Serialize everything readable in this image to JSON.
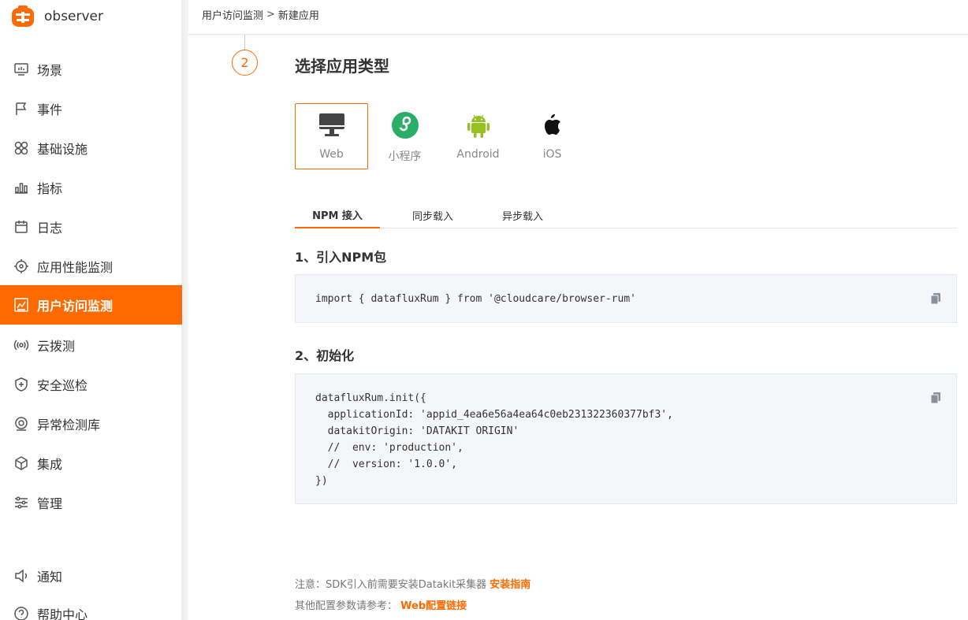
{
  "brand": {
    "name": "observer"
  },
  "sidebar": {
    "items": [
      {
        "label": "场景",
        "icon": "monitor-icon"
      },
      {
        "label": "事件",
        "icon": "flag-icon"
      },
      {
        "label": "基础设施",
        "icon": "infrastructure-icon"
      },
      {
        "label": "指标",
        "icon": "bar-chart-icon"
      },
      {
        "label": "日志",
        "icon": "calendar-icon"
      },
      {
        "label": "应用性能监测",
        "icon": "target-icon"
      },
      {
        "label": "用户访问监测",
        "icon": "line-chart-icon",
        "active": true
      },
      {
        "label": "云拨测",
        "icon": "broadcast-icon"
      },
      {
        "label": "安全巡检",
        "icon": "shield-icon"
      },
      {
        "label": "异常检测库",
        "icon": "alert-icon"
      },
      {
        "label": "集成",
        "icon": "cube-icon"
      },
      {
        "label": "管理",
        "icon": "sliders-icon"
      }
    ],
    "bottom": [
      {
        "label": "通知",
        "icon": "speaker-icon"
      },
      {
        "label": "帮助中心",
        "icon": "help-icon"
      }
    ]
  },
  "breadcrumb": {
    "parent": "用户访问监测",
    "separator": ">",
    "current": "新建应用"
  },
  "step": {
    "number": "2",
    "title": "选择应用类型"
  },
  "app_types": [
    {
      "label": "Web",
      "selected": true
    },
    {
      "label": "小程序"
    },
    {
      "label": "Android"
    },
    {
      "label": "iOS"
    }
  ],
  "tabs": [
    {
      "label": "NPM 接入",
      "active": true
    },
    {
      "label": "同步载入"
    },
    {
      "label": "异步载入"
    }
  ],
  "section1": {
    "title": "1、引入NPM包",
    "code": "import { datafluxRum } from '@cloudcare/browser-rum'"
  },
  "section2": {
    "title": "2、初始化",
    "code": "datafluxRum.init({\n  applicationId: 'appid_4ea6e56a4ea64c0eb231322360377bf3',\n  datakitOrigin: 'DATAKIT ORIGIN'\n  //  env: 'production',\n  //  version: '1.0.0',\n})"
  },
  "notes": {
    "line1_text": "注意：SDK引入前需要安装Datakit采集器",
    "line1_link": "安装指南",
    "line2_text": "其他配置参数请参考：",
    "line2_link": "Web配置链接"
  },
  "colors": {
    "accent": "#ff6a00",
    "wechat_green": "#2aae67",
    "android_green": "#97c024"
  }
}
